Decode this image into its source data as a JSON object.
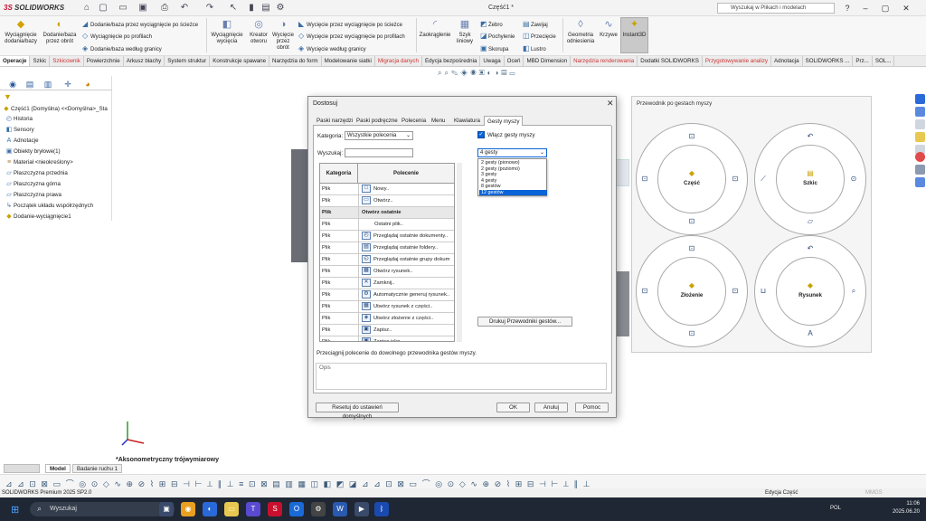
{
  "app": {
    "logo_a": "3S",
    "logo_b": "SOLIDWORKS",
    "doc_title": "Część1 *",
    "search_placeholder": "Wyszukaj w Plikach i modelach"
  },
  "ribbon": {
    "extrude_boss": "Wyciągnięcie dodania/bazy",
    "revolve_boss": "Dodanie/baza przez obrót",
    "swept_boss": "Dodanie/baza przez wyciągnięcie po ścieżce",
    "lofted_boss": "Wyciągnięcie po profilach",
    "boundary_boss": "Dodanie/baza według granicy",
    "extrude_cut": "Wyciągnięcie wycięcia",
    "hole_wizard": "Kreator otworu",
    "revolve_cut": "Wycięcie przez obrót",
    "swept_cut": "Wycięcie przez wyciągnięcie po ścieżce",
    "lofted_cut": "Wycięcie przez wyciągnięcie po profilach",
    "boundary_cut": "Wycięcie według granicy",
    "fillet": "Zaokrąglenie",
    "linear_pattern": "Szyk liniowy",
    "rib": "Żebro",
    "draft": "Pochylenie",
    "shell": "Skorupa",
    "wrap": "Zawijaj",
    "intersect": "Przecięcie",
    "mirror": "Lustro",
    "ref_geometry": "Geometria odniesienia",
    "curves": "Krzywe",
    "instant3d": "Instant3D"
  },
  "tabs": [
    "Operacje",
    "Szkic",
    "Szkicownik",
    "Powierzchnie",
    "Arkusz blachy",
    "System struktur",
    "Konstrukcje spawane",
    "Narzędzia do form",
    "Modelowanie siatki",
    "Migracja danych",
    "Edycja bezpośrednia",
    "Uwaga",
    "Oceń",
    "MBD Dimension",
    "Narzędzia renderowania",
    "Dodatki SOLIDWORKS",
    "Przygotowywanie analizy",
    "Adnotacja",
    "SOLIDWORKS ...",
    "Prz...",
    "SOL..."
  ],
  "tree": {
    "root": "Część1 (Domyślna) <<Domyślna>_Sta",
    "items": [
      "Historia",
      "Sensory",
      "Adnotacje",
      "Obiekty bryłowe(1)",
      "Materiał <nieokreślony>",
      "Płaszczyzna przednia",
      "Płaszczyzna górna",
      "Płaszczyzna prawa",
      "Początek układu współrzędnych",
      "Dodanie-wyciągnięcie1"
    ]
  },
  "view_label": "*Aksonometryczny trójwymiarowy",
  "model_tabs": [
    "Model",
    "Badanie ruchu 1"
  ],
  "status": {
    "left": "SOLIDWORKS Premium 2025 SP2.0",
    "mid": "Edycja Część",
    "units": "MMGS"
  },
  "taskbar": {
    "search": "Wyszukaj",
    "lang": "POL",
    "time": "11:06",
    "date": "2025.06.20"
  },
  "dialog": {
    "title": "Dostosuj",
    "tabs": [
      "Paski narzędzi",
      "Paski podręczne",
      "Polecenia",
      "Menu",
      "Klawiatura",
      "Gesty myszy"
    ],
    "category_label": "Kategoria:",
    "category_value": "Wszystkie polecenia",
    "search_label": "Wyszukaj:",
    "enable_gestures": "Włącz gesty myszy",
    "gestures_value": "4 gesty",
    "gesture_options": [
      "2 gesty (pionowo)",
      "2 gesty (poziomo)",
      "3 gesty",
      "4 gesty",
      "8 gestów",
      "12 gestów"
    ],
    "col_category": "Kategoria",
    "col_command": "Polecenie",
    "rows": [
      {
        "cat": "Plik",
        "cmd": "Nowy..",
        "icon": "new-icon",
        "glyph": "□"
      },
      {
        "cat": "Plik",
        "cmd": "Otwórz..",
        "icon": "open-icon",
        "glyph": "▭"
      },
      {
        "cat": "Plik",
        "cmd": "Otwórz ostatnie",
        "icon": "",
        "glyph": "",
        "hdr": true
      },
      {
        "cat": "Plik",
        "cmd": "Ostatni plik..",
        "icon": "",
        "glyph": ""
      },
      {
        "cat": "Plik",
        "cmd": "Przeglądaj ostatnie dokumenty..",
        "icon": "recent-docs-icon",
        "glyph": "◴"
      },
      {
        "cat": "Plik",
        "cmd": "Przeglądaj ostatnie foldery..",
        "icon": "recent-folders-icon",
        "glyph": "▤"
      },
      {
        "cat": "Plik",
        "cmd": "Przeglądaj ostatnie grupy dokum",
        "icon": "recent-groups-icon",
        "glyph": "◵"
      },
      {
        "cat": "Plik",
        "cmd": "Otwórz rysunek..",
        "icon": "open-drawing-icon",
        "glyph": "▦"
      },
      {
        "cat": "Plik",
        "cmd": "Zamknij..",
        "icon": "close-file-icon",
        "glyph": "✕"
      },
      {
        "cat": "Plik",
        "cmd": "Automatycznie generuj rysunek..",
        "icon": "auto-drawing-icon",
        "glyph": "⚙"
      },
      {
        "cat": "Plik",
        "cmd": "Utwórz rysunek z części..",
        "icon": "make-drawing-icon",
        "glyph": "▦"
      },
      {
        "cat": "Plik",
        "cmd": "Utwórz złożenie z części..",
        "icon": "make-assembly-icon",
        "glyph": "◈"
      },
      {
        "cat": "Plik",
        "cmd": "Zapisz..",
        "icon": "save-icon",
        "glyph": "▣"
      },
      {
        "cat": "Plik",
        "cmd": "Zapisz jako..",
        "icon": "save-as-icon",
        "glyph": "▣"
      }
    ],
    "print_guides": "Drukuj Przewodniki gestów...",
    "hint": "Przeciągnij polecenie do dowolnego przewodnika gestów myszy.",
    "desc_label": "Opis",
    "reset": "Resetuj do ustawień domyślnych",
    "ok": "OK",
    "cancel": "Anuluj",
    "help": "Pomoc"
  },
  "guide": {
    "title": "Przewodnik po gestach myszy",
    "circles": [
      "Część",
      "Szkic",
      "Złożenie",
      "Rysunek"
    ]
  }
}
